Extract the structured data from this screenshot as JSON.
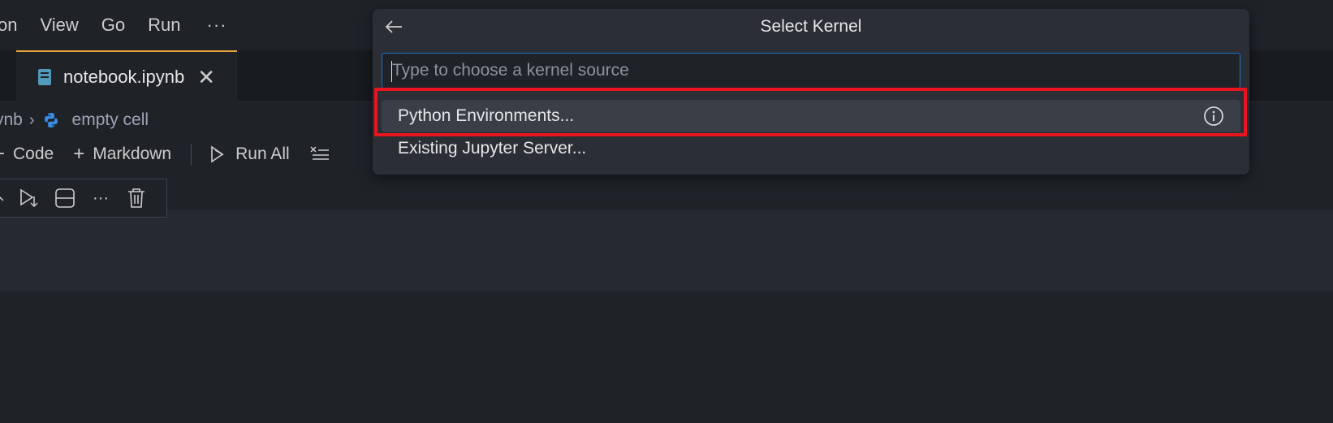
{
  "menubar": {
    "items": [
      "on",
      "View",
      "Go",
      "Run"
    ],
    "more": "···"
  },
  "tab": {
    "filename": "notebook.ipynb",
    "close": "✕"
  },
  "breadcrumb": {
    "first": "ynb",
    "separator": "›",
    "cell": "empty cell"
  },
  "notebook_toolbar": {
    "code_label": "Code",
    "markdown_label": "Markdown",
    "run_all_label": "Run All"
  },
  "quick_pick": {
    "title": "Select Kernel",
    "input_placeholder": "Type to choose a kernel source",
    "input_value": "",
    "items": [
      {
        "label": "Python Environments...",
        "selected": true
      },
      {
        "label": "Existing Jupyter Server...",
        "selected": false
      }
    ]
  },
  "colors": {
    "accent_tab": "#e8a33d",
    "focus_border": "#1f6fc5",
    "highlight": "#e8141f",
    "python_icon": "#3b8eea"
  },
  "icons": {
    "back": "arrow-left-icon",
    "info": "info-icon",
    "file": "notebook-file-icon",
    "python": "python-icon",
    "delete": "trash-icon"
  }
}
